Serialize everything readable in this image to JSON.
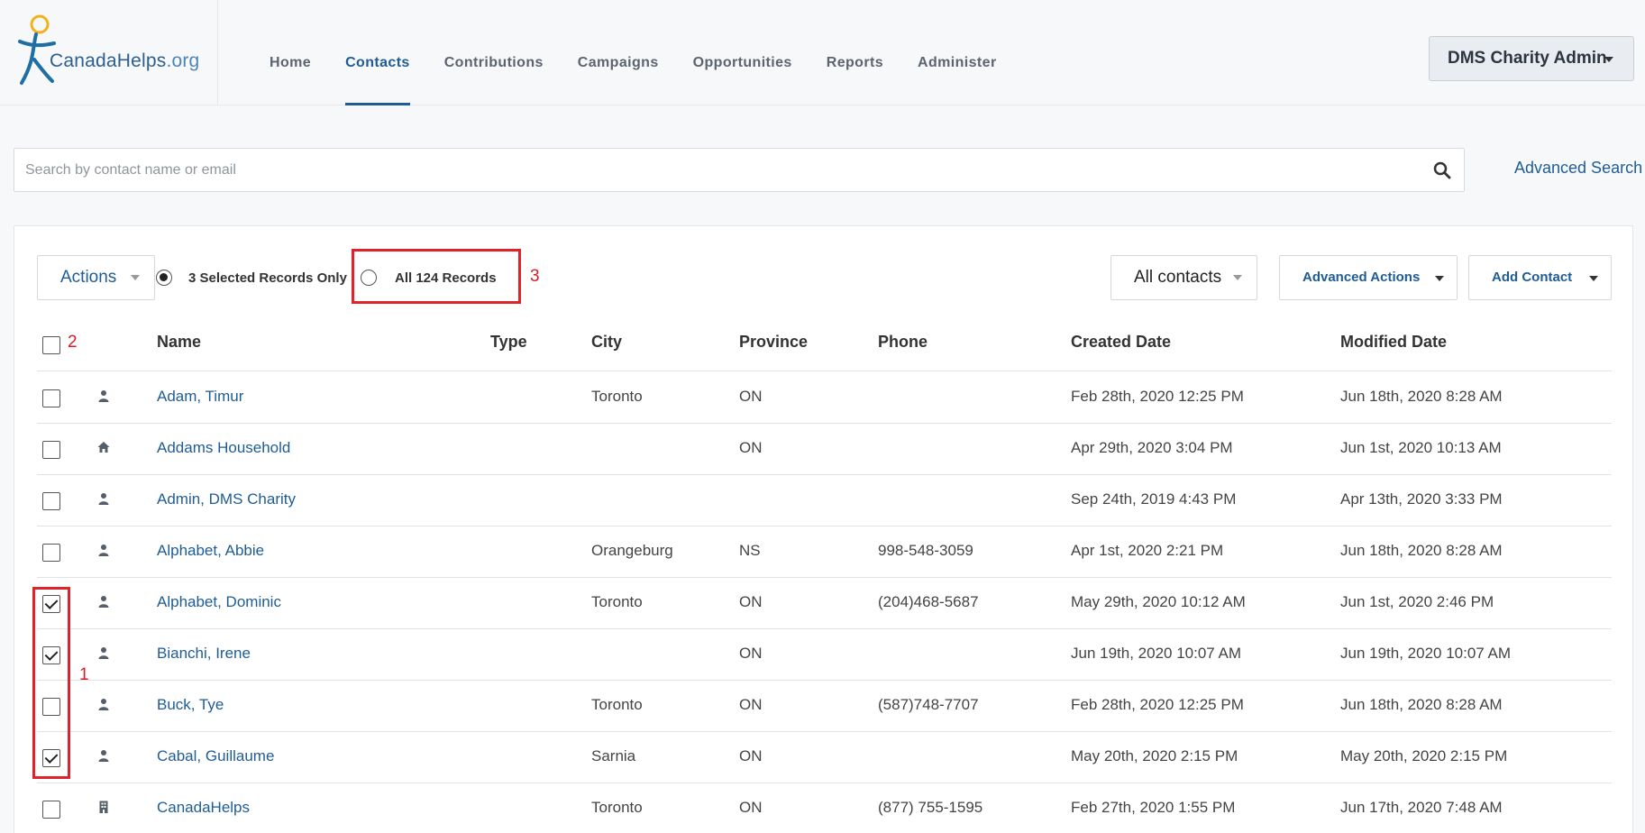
{
  "brand": {
    "logo_main": "CanadaHelps",
    "logo_suffix": ".org"
  },
  "nav": {
    "items": [
      {
        "label": "Home",
        "active": false
      },
      {
        "label": "Contacts",
        "active": true
      },
      {
        "label": "Contributions",
        "active": false
      },
      {
        "label": "Campaigns",
        "active": false
      },
      {
        "label": "Opportunities",
        "active": false
      },
      {
        "label": "Reports",
        "active": false
      },
      {
        "label": "Administer",
        "active": false
      }
    ]
  },
  "user_menu": {
    "label": "DMS Charity Admin"
  },
  "search": {
    "placeholder": "Search by contact name or email",
    "value": "",
    "advanced_label": "Advanced Search"
  },
  "toolbar": {
    "actions_label": "Actions",
    "selected_option": "3 Selected Records Only",
    "all_option": "All 124 Records",
    "filter_label": "All contacts",
    "advanced_actions_label": "Advanced Actions",
    "add_contact_label": "Add Contact"
  },
  "annotations": {
    "one": "1",
    "two": "2",
    "three": "3"
  },
  "table": {
    "headers": {
      "name": "Name",
      "type": "Type",
      "city": "City",
      "province": "Province",
      "phone": "Phone",
      "created": "Created Date",
      "modified": "Modified Date"
    },
    "rows": [
      {
        "checked": false,
        "icon": "person-icon",
        "name": "Adam, Timur",
        "type": "",
        "city": "Toronto",
        "province": "ON",
        "phone": "",
        "created": "Feb 28th, 2020 12:25 PM",
        "modified": "Jun 18th, 2020 8:28 AM"
      },
      {
        "checked": false,
        "icon": "home-icon",
        "name": "Addams Household",
        "type": "",
        "city": "",
        "province": "ON",
        "phone": "",
        "created": "Apr 29th, 2020 3:04 PM",
        "modified": "Jun 1st, 2020 10:13 AM"
      },
      {
        "checked": false,
        "icon": "person-icon",
        "name": "Admin, DMS Charity",
        "type": "",
        "city": "",
        "province": "",
        "phone": "",
        "created": "Sep 24th, 2019 4:43 PM",
        "modified": "Apr 13th, 2020 3:33 PM"
      },
      {
        "checked": false,
        "icon": "person-icon",
        "name": "Alphabet, Abbie",
        "type": "",
        "city": "Orangeburg",
        "province": "NS",
        "phone": "998-548-3059",
        "created": "Apr 1st, 2020 2:21 PM",
        "modified": "Jun 18th, 2020 8:28 AM"
      },
      {
        "checked": true,
        "icon": "person-icon",
        "name": "Alphabet, Dominic",
        "type": "",
        "city": "Toronto",
        "province": "ON",
        "phone": "(204)468-5687",
        "created": "May 29th, 2020 10:12 AM",
        "modified": "Jun 1st, 2020 2:46 PM"
      },
      {
        "checked": true,
        "icon": "person-icon",
        "name": "Bianchi, Irene",
        "type": "",
        "city": "",
        "province": "ON",
        "phone": "",
        "created": "Jun 19th, 2020 10:07 AM",
        "modified": "Jun 19th, 2020 10:07 AM"
      },
      {
        "checked": false,
        "icon": "person-icon",
        "name": "Buck, Tye",
        "type": "",
        "city": "Toronto",
        "province": "ON",
        "phone": "(587)748-7707",
        "created": "Feb 28th, 2020 12:25 PM",
        "modified": "Jun 18th, 2020 8:28 AM"
      },
      {
        "checked": true,
        "icon": "person-icon",
        "name": "Cabal, Guillaume",
        "type": "",
        "city": "Sarnia",
        "province": "ON",
        "phone": "",
        "created": "May 20th, 2020 2:15 PM",
        "modified": "May 20th, 2020 2:15 PM"
      },
      {
        "checked": false,
        "icon": "building-icon",
        "name": "CanadaHelps",
        "type": "",
        "city": "Toronto",
        "province": "ON",
        "phone": "(877) 755-1595",
        "created": "Feb 27th, 2020 1:55 PM",
        "modified": "Jun 17th, 2020 7:48 AM"
      }
    ]
  }
}
